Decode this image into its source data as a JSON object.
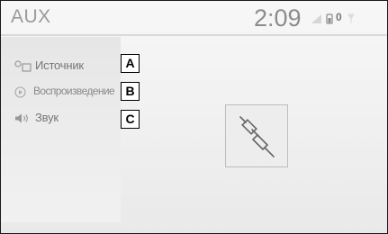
{
  "header": {
    "title": "AUX",
    "clock": "2:09",
    "status_value": "0"
  },
  "menu": {
    "items": [
      {
        "label": "Источник",
        "icon": "source-icon",
        "callout": "A"
      },
      {
        "label": "Воспроизведение",
        "icon": "play-icon",
        "callout": "B"
      },
      {
        "label": "Звук",
        "icon": "speaker-icon",
        "callout": "C"
      }
    ]
  },
  "main": {
    "artwork_icon": "aux-cable-icon"
  },
  "colors": {
    "text_muted": "#8c8c8c",
    "panel": "#e6e6e6",
    "border": "#1a1a1a"
  }
}
